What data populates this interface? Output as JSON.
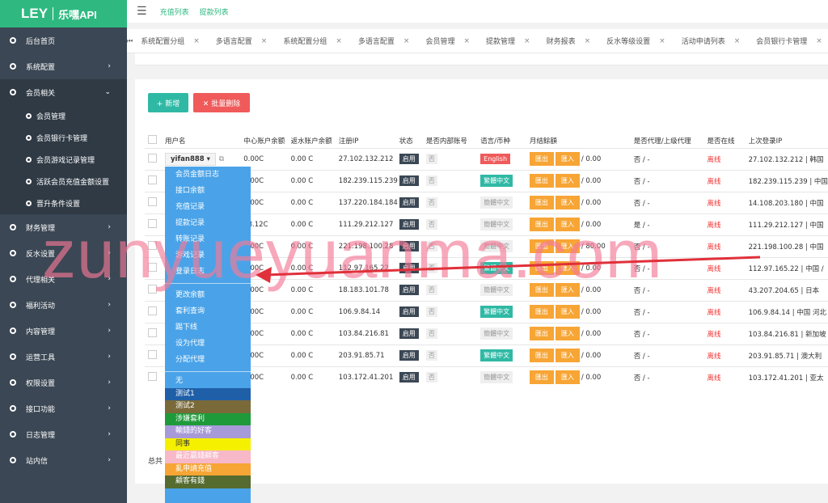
{
  "logo": {
    "brand": "LEY",
    "sub": "乐嘿API"
  },
  "sidebar": {
    "items": [
      {
        "label": "后台首页",
        "arrow": ""
      },
      {
        "label": "系统配置",
        "arrow": "›"
      },
      {
        "label": "会员相关",
        "arrow": "⌄"
      },
      {
        "label": "财务管理",
        "arrow": "›"
      },
      {
        "label": "反水设置",
        "arrow": "›"
      },
      {
        "label": "代理相关",
        "arrow": "›"
      },
      {
        "label": "福利活动",
        "arrow": "›"
      },
      {
        "label": "内容管理",
        "arrow": "›"
      },
      {
        "label": "运营工具",
        "arrow": "›"
      },
      {
        "label": "权限设置",
        "arrow": "›"
      },
      {
        "label": "接口功能",
        "arrow": "›"
      },
      {
        "label": "日志管理",
        "arrow": "›"
      },
      {
        "label": "站内信",
        "arrow": "›"
      }
    ],
    "sub_items": [
      "会员管理",
      "会员银行卡管理",
      "会员游戏记录管理",
      "活跃会员充值金额设置",
      "晋升条件设置"
    ]
  },
  "topbar": {
    "links": [
      "充值列表",
      "提款列表"
    ]
  },
  "tabs": [
    "系统配置分组",
    "多语言配置",
    "系统配置分组",
    "多语言配置",
    "会员管理",
    "提款管理",
    "财务报表",
    "反水等级设置",
    "活动申请列表",
    "会员银行卡管理"
  ],
  "toolbar": {
    "add_label": "+ 新增",
    "batch_delete_label": "✕ 批量删除"
  },
  "table": {
    "headers": [
      "用户名",
      "中心账户余额",
      "返水账户余额",
      "注册IP",
      "状态",
      "是否内部账号",
      "语言/币种",
      "月结餘額",
      "是否代理/上级代理",
      "是否在线",
      "上次登录IP"
    ],
    "rows": [
      {
        "user": "yifan888 ▾",
        "center": "0.00",
        "rebate": "0.00",
        "ip": "27.102.132.212",
        "status": "启用",
        "internal": "否",
        "lang": "English",
        "lang_color": "red",
        "monthly": "/ 0.00",
        "agent": "否 / -",
        "online": "离线",
        "last_ip": "27.102.132.212 | 韩国"
      },
      {
        "user": "",
        "center": "0.00",
        "rebate": "0.00",
        "ip": "182.239.115.239",
        "status": "启用",
        "internal": "否",
        "lang": "繁體中文",
        "lang_color": "green",
        "monthly": "/ 0.00",
        "agent": "否 / -",
        "online": "离线",
        "last_ip": "182.239.115.239 | 中国"
      },
      {
        "user": "",
        "center": "0.00",
        "rebate": "0.00",
        "ip": "137.220.184.184",
        "status": "启用",
        "internal": "否",
        "lang": "簡體中文",
        "lang_color": "grey",
        "monthly": "/ 0.00",
        "agent": "否 / -",
        "online": "离线",
        "last_ip": "14.108.203.180 | 中国"
      },
      {
        "user": "",
        "center": "88.12",
        "rebate": "0.00",
        "ip": "111.29.212.127",
        "status": "启用",
        "internal": "否",
        "lang": "簡體中文",
        "lang_color": "grey",
        "monthly": "/ 0.00",
        "agent": "是 / -",
        "online": "离线",
        "last_ip": "111.29.212.127 | 中国"
      },
      {
        "user": "",
        "center": "0.00",
        "rebate": "0.00",
        "ip": "221.198.100.28",
        "status": "启用",
        "internal": "否",
        "lang": "簡體中文",
        "lang_color": "grey",
        "monthly": "/ 80.00",
        "agent": "否 / -",
        "online": "离线",
        "last_ip": "221.198.100.28 | 中国"
      },
      {
        "user": "",
        "center": "0.00",
        "rebate": "0.00",
        "ip": "112.97.165.22",
        "status": "启用",
        "internal": "否",
        "lang": "繁體中文",
        "lang_color": "green",
        "monthly": "/ 0.00",
        "agent": "否 / -",
        "online": "离线",
        "last_ip": "112.97.165.22 | 中国 /"
      },
      {
        "user": "",
        "center": "0.00",
        "rebate": "0.00",
        "ip": "18.183.101.78",
        "status": "启用",
        "internal": "否",
        "lang": "簡體中文",
        "lang_color": "grey",
        "monthly": "/ 0.00",
        "agent": "否 / -",
        "online": "离线",
        "last_ip": "43.207.204.65 | 日本"
      },
      {
        "user": "",
        "center": "0.00",
        "rebate": "0.00",
        "ip": "106.9.84.14",
        "status": "启用",
        "internal": "否",
        "lang": "繁體中文",
        "lang_color": "green",
        "monthly": "/ 0.00",
        "agent": "否 / -",
        "online": "离线",
        "last_ip": "106.9.84.14 | 中国 河北"
      },
      {
        "user": "",
        "center": "0.00",
        "rebate": "0.00",
        "ip": "103.84.216.81",
        "status": "启用",
        "internal": "否",
        "lang": "簡體中文",
        "lang_color": "grey",
        "monthly": "/ 0.00",
        "agent": "否 / -",
        "online": "离线",
        "last_ip": "103.84.216.81 | 新加坡"
      },
      {
        "user": "",
        "center": "0.00",
        "rebate": "0.00",
        "ip": "203.91.85.71",
        "status": "启用",
        "internal": "否",
        "lang": "繁體中文",
        "lang_color": "green",
        "monthly": "/ 0.00",
        "agent": "否 / -",
        "online": "离线",
        "last_ip": "203.91.85.71 | 澳大利"
      },
      {
        "user": "",
        "center": "0.00",
        "rebate": "0.00",
        "ip": "103.172.41.201",
        "status": "启用",
        "internal": "否",
        "lang": "簡體中文",
        "lang_color": "grey",
        "monthly": "/ 0.00",
        "agent": "否 / -",
        "online": "离线",
        "last_ip": "103.172.41.201 | 亚太"
      }
    ],
    "action_out": "匯出",
    "action_in": "匯入",
    "refresh_icon": "C"
  },
  "footer": {
    "total": "总共"
  },
  "dropdown": {
    "group1": [
      "会员金额日志",
      "接口余额",
      "充值记录",
      "提款记录",
      "转账记录",
      "游戏记录",
      "登录日志"
    ],
    "group2": [
      "更改余额",
      "套利查询",
      "踢下线",
      "设为代理",
      "分配代理"
    ],
    "levels": [
      {
        "label": "无",
        "color": "#4aa3e8"
      },
      {
        "label": "测试1",
        "color": "#1f5fa8"
      },
      {
        "label": "测试2",
        "color": "#7a6a3a"
      },
      {
        "label": "涉嫌套利",
        "color": "#1f9a3a"
      },
      {
        "label": "輸錢的好客",
        "color": "#a79ad8"
      },
      {
        "label": "同事",
        "color": "#f5f000"
      },
      {
        "label": "最近贏錢顧客",
        "color": "#f7b8c8"
      },
      {
        "label": "亂申請充值",
        "color": "#f7a535"
      },
      {
        "label": "顧客有錢",
        "color": "#556b2f"
      }
    ]
  },
  "watermark": "zunyueyuanma.com",
  "colors": {
    "accent": "#2fb981",
    "sidebar": "#3b4754",
    "danger": "#f05a5a",
    "arrow": "#e0303a"
  }
}
